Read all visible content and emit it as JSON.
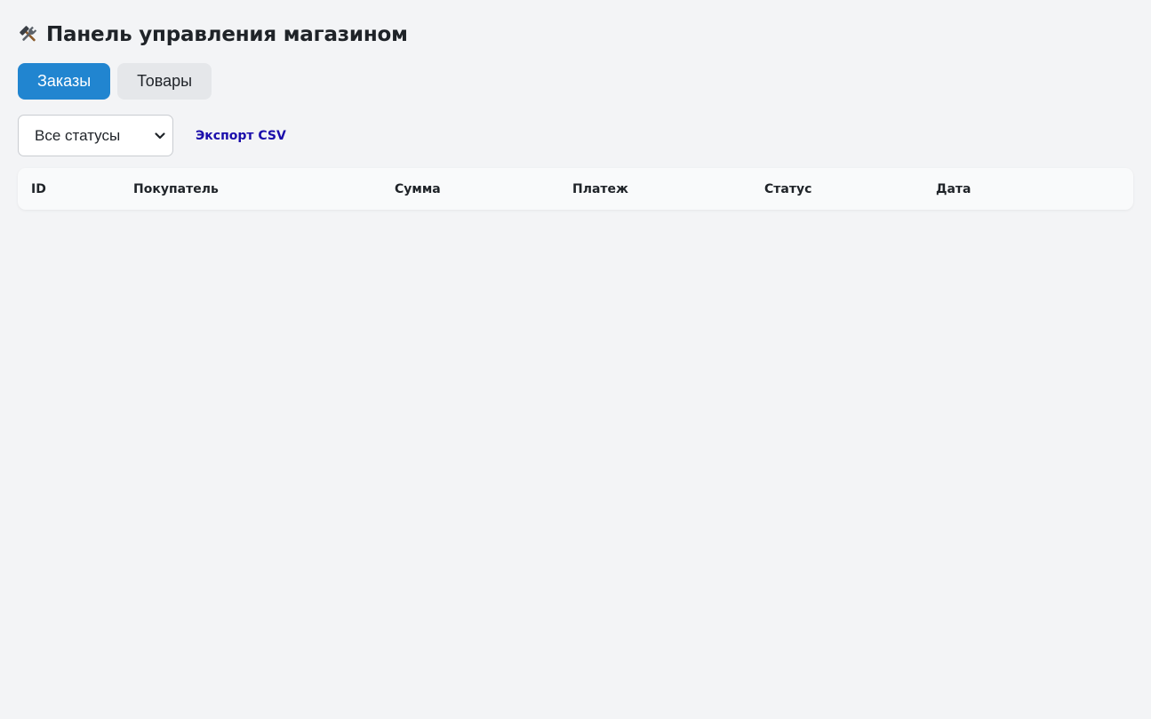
{
  "header": {
    "icon": "hammer-and-wrench-icon",
    "title": "Панель управления магазином"
  },
  "tabs": [
    {
      "label": "Заказы",
      "active": true
    },
    {
      "label": "Товары",
      "active": false
    }
  ],
  "toolbar": {
    "status_filter": {
      "selected": "Все статусы"
    },
    "export_label": "Экспорт CSV"
  },
  "orders_table": {
    "columns": [
      "ID",
      "Покупатель",
      "Сумма",
      "Платеж",
      "Статус",
      "Дата"
    ],
    "rows": []
  },
  "colors": {
    "accent": "#2185d0",
    "link": "#1a0dab",
    "background": "#f3f4f6"
  }
}
